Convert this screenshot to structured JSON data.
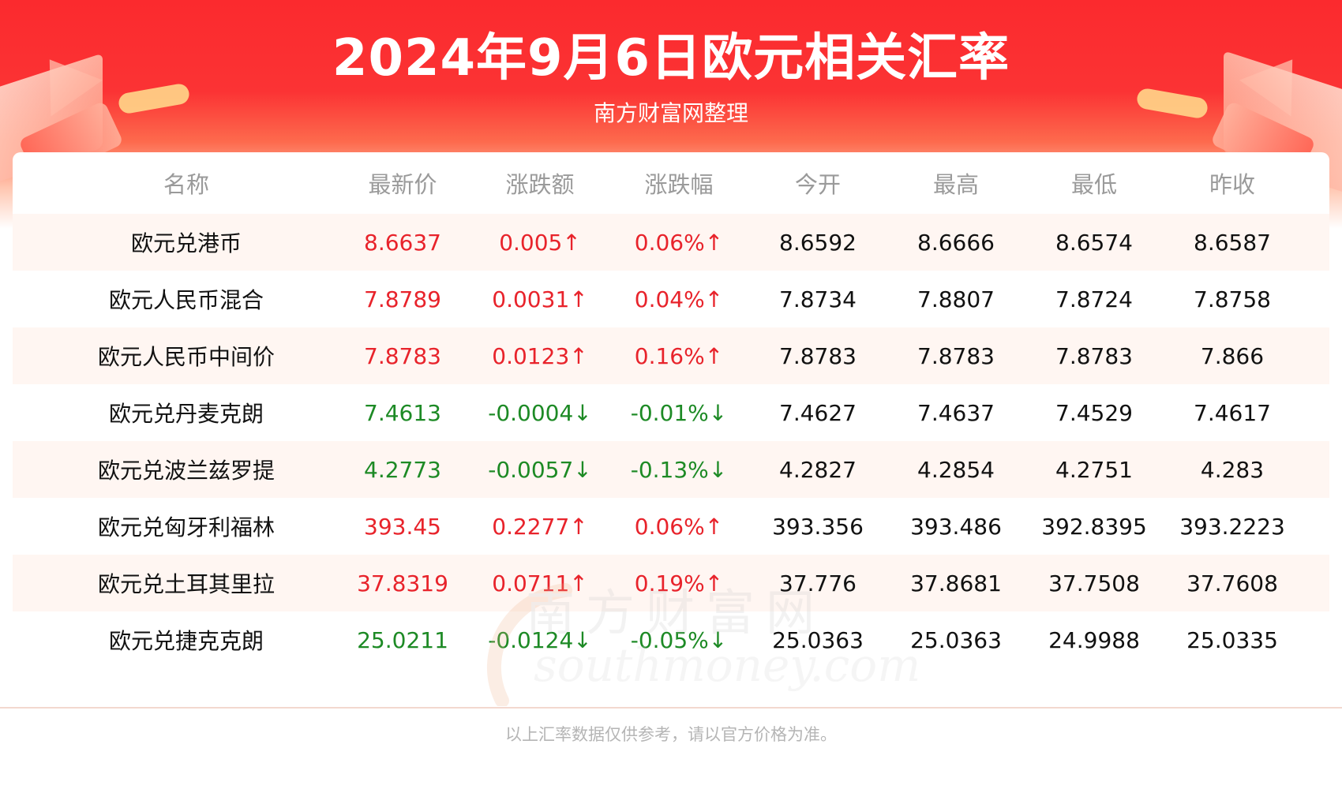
{
  "title": "2024年9月6日欧元相关汇率",
  "subtitle": "南方财富网整理",
  "watermark": {
    "cn": "南方财富网",
    "en": "southmoney.com"
  },
  "colors": {
    "up": "#e8232b",
    "down": "#1d8a25",
    "header_red": "#fb2a2e"
  },
  "table": {
    "headers": [
      "名称",
      "最新价",
      "涨跌额",
      "涨跌幅",
      "今开",
      "最高",
      "最低",
      "昨收"
    ],
    "rows": [
      {
        "name": "欧元兑港币",
        "latest": "8.6637",
        "change": "0.005↑",
        "pct": "0.06%↑",
        "open": "8.6592",
        "high": "8.6666",
        "low": "8.6574",
        "prev": "8.6587",
        "trend": "up"
      },
      {
        "name": "欧元人民币混合",
        "latest": "7.8789",
        "change": "0.0031↑",
        "pct": "0.04%↑",
        "open": "7.8734",
        "high": "7.8807",
        "low": "7.8724",
        "prev": "7.8758",
        "trend": "up"
      },
      {
        "name": "欧元人民币中间价",
        "latest": "7.8783",
        "change": "0.0123↑",
        "pct": "0.16%↑",
        "open": "7.8783",
        "high": "7.8783",
        "low": "7.8783",
        "prev": "7.866",
        "trend": "up"
      },
      {
        "name": "欧元兑丹麦克朗",
        "latest": "7.4613",
        "change": "-0.0004↓",
        "pct": "-0.01%↓",
        "open": "7.4627",
        "high": "7.4637",
        "low": "7.4529",
        "prev": "7.4617",
        "trend": "down"
      },
      {
        "name": "欧元兑波兰兹罗提",
        "latest": "4.2773",
        "change": "-0.0057↓",
        "pct": "-0.13%↓",
        "open": "4.2827",
        "high": "4.2854",
        "low": "4.2751",
        "prev": "4.283",
        "trend": "down"
      },
      {
        "name": "欧元兑匈牙利福林",
        "latest": "393.45",
        "change": "0.2277↑",
        "pct": "0.06%↑",
        "open": "393.356",
        "high": "393.486",
        "low": "392.8395",
        "prev": "393.2223",
        "trend": "up"
      },
      {
        "name": "欧元兑土耳其里拉",
        "latest": "37.8319",
        "change": "0.0711↑",
        "pct": "0.19%↑",
        "open": "37.776",
        "high": "37.8681",
        "low": "37.7508",
        "prev": "37.7608",
        "trend": "up"
      },
      {
        "name": "欧元兑捷克克朗",
        "latest": "25.0211",
        "change": "-0.0124↓",
        "pct": "-0.05%↓",
        "open": "25.0363",
        "high": "25.0363",
        "low": "24.9988",
        "prev": "25.0335",
        "trend": "down"
      }
    ]
  },
  "footer": "以上汇率数据仅供参考，请以官方价格为准。"
}
